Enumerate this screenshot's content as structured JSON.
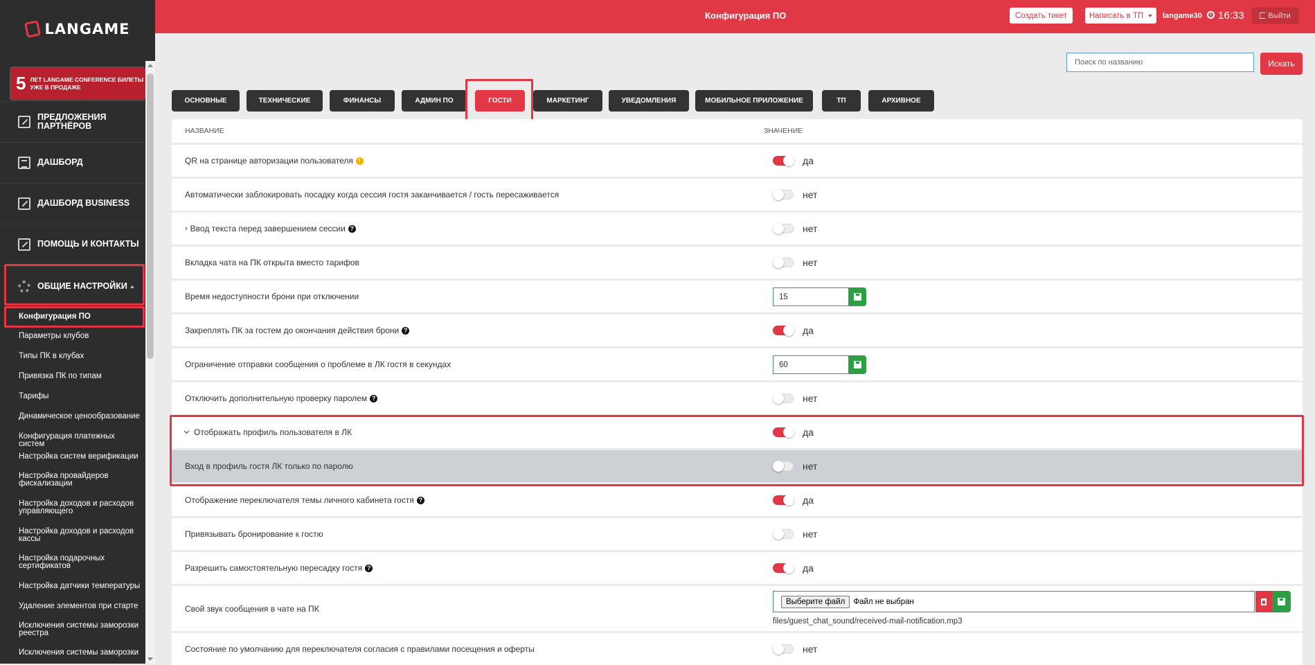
{
  "app": {
    "logo_text": "LANGAME"
  },
  "promo": {
    "number": "5",
    "text": "лет Langame conference билеты уже в продаже"
  },
  "sidebar": {
    "nav": [
      {
        "label": "ПРЕДЛОЖЕНИЯ ПАРТНЁРОВ"
      },
      {
        "label": "ДАШБОРД"
      },
      {
        "label": "ДАШБОРД BUSINESS"
      },
      {
        "label": "ПОМОЩЬ И КОНТАКТЫ"
      },
      {
        "label": "ОБЩИЕ НАСТРОЙКИ"
      }
    ],
    "subitems": [
      "Конфигурация ПО",
      "Параметры клубов",
      "Типы ПК в клубах",
      "Привязка ПК по типам",
      "Тарифы",
      "Динамическое ценообразование",
      "Конфигурация платежных систем",
      "Настройка систем верификации",
      "Настройка провайдеров фискализации",
      "Настройка доходов и расходов управляющего",
      "Настройка доходов и расходов кассы",
      "Настройка подарочных сертификатов",
      "Настройка датчики температуры",
      "Удаление элементов при старте",
      "Исключения системы заморозки реестра",
      "Исключения системы заморозки"
    ]
  },
  "header": {
    "title": "Конфигурация ПО",
    "create_ticket": "Создать тикет",
    "write_tp": "Написать в ТП",
    "user": "langame30",
    "time": "16:33",
    "logout": "Выйти"
  },
  "search": {
    "placeholder": "Поиск по названию",
    "button": "Искать"
  },
  "tabs": [
    "ОСНОВНЫЕ",
    "ТЕХНИЧЕСКИЕ",
    "ФИНАНСЫ",
    "АДМИН ПО",
    "ГОСТИ",
    "МАРКЕТИНГ",
    "УВЕДОМЛЕНИЯ",
    "МОБИЛЬНОЕ ПРИЛОЖЕНИЕ",
    "ТП",
    "АРХИВНОЕ"
  ],
  "active_tab": "ГОСТИ",
  "table": {
    "col_name": "НАЗВАНИЕ",
    "col_value": "ЗНАЧЕНИЕ",
    "rows": [
      {
        "name": "QR на странице авторизации пользователя",
        "type": "toggle",
        "on": true,
        "value": "да",
        "icon": "info"
      },
      {
        "name": "Автоматически заблокировать посадку когда сессия гостя заканчивается / гость пересаживается",
        "type": "toggle",
        "on": false,
        "value": "нет"
      },
      {
        "name": "Ввод текста перед завершением сессии",
        "type": "toggle",
        "on": false,
        "value": "нет",
        "icon": "help",
        "prefix": "›"
      },
      {
        "name": "Вкладка чата на ПК открыта вместо тарифов",
        "type": "toggle",
        "on": false,
        "value": "нет"
      },
      {
        "name": "Время недоступности брони при отключении",
        "type": "input",
        "value": "15"
      },
      {
        "name": "Закреплять ПК за гостем до окончания действия брони",
        "type": "toggle",
        "on": true,
        "value": "да",
        "icon": "help"
      },
      {
        "name": "Ограничение отправки сообщения о проблеме в ЛК гостя в секундах",
        "type": "input",
        "value": "60"
      },
      {
        "name": "Отключить дополнительную проверку паролем",
        "type": "toggle",
        "on": false,
        "value": "нет",
        "icon": "help"
      },
      {
        "name": "Отображать профиль пользователя в ЛК",
        "type": "toggle",
        "on": true,
        "value": "да",
        "expanded": true
      },
      {
        "name": "Вход в профиль гостя ЛК только по паролю",
        "type": "toggle",
        "on": false,
        "value": "нет",
        "grey": true
      },
      {
        "name": "Отображение переключателя темы личного кабинета гостя",
        "type": "toggle",
        "on": true,
        "value": "да",
        "icon": "help"
      },
      {
        "name": "Привязывать бронирование к гостю",
        "type": "toggle",
        "on": false,
        "value": "нет"
      },
      {
        "name": "Разрешить самостоятельную пересадку гостя",
        "type": "toggle",
        "on": true,
        "value": "да",
        "icon": "help"
      },
      {
        "name": "Свой звук сообщения в чате на ПК",
        "type": "file",
        "file_button": "Выберите файл",
        "file_status": "Файл не выбран",
        "path": "files/guest_chat_sound/received-mail-notification.mp3"
      },
      {
        "name": "Состояние по умолчанию для переключателя согласия с правилами посещения и оферты",
        "type": "toggle",
        "on": false,
        "value": "нет"
      }
    ]
  },
  "colors": {
    "accent": "#e23744",
    "sidebar": "#2d2d2d",
    "success": "#2e9e44"
  }
}
